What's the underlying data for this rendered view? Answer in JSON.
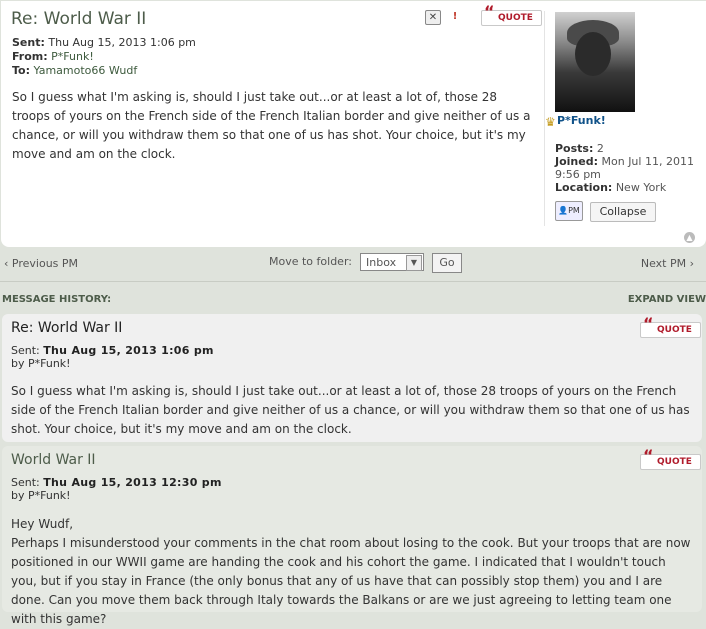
{
  "current_pm": {
    "title": "Re: World War II",
    "sent_label": "Sent:",
    "sent_value": "Thu Aug 15, 2013 1:06 pm",
    "from_label": "From:",
    "from_value": "P*Funk!",
    "to_label": "To:",
    "to_value": "Yamamoto66 Wudf",
    "quote_label": "QUOTE",
    "body": "So I guess what I'm asking is, should I just take out...or at least a lot of, those 28 troops of yours on the French side of the French Italian border and give neither of us a chance, or will you withdraw them so that one of us has shot. Your choice, but it's my move and am on the clock."
  },
  "profile": {
    "username": "P*Funk!",
    "posts_label": "Posts:",
    "posts_value": "2",
    "joined_label": "Joined:",
    "joined_value": "Mon Jul 11, 2011 9:56 pm",
    "location_label": "Location:",
    "location_value": "New York",
    "pm_label": "PM",
    "collapse_label": "Collapse"
  },
  "navigation": {
    "prev": "Previous PM",
    "next": "Next PM",
    "folder_label": "Move to folder:",
    "folder_selected": "Inbox",
    "go_label": "Go"
  },
  "history": {
    "header": "MESSAGE HISTORY:",
    "expand": "EXPAND VIEW",
    "messages": [
      {
        "title": "Re: World War II",
        "sent_label": "Sent:",
        "sent_value": "Thu Aug 15, 2013 1:06 pm",
        "by": "by P*Funk!",
        "quote_label": "QUOTE",
        "body": "So I guess what I'm asking is, should I just take out...or at least a lot of, those 28 troops of yours on the French side of the French Italian border and give neither of us a chance, or will you withdraw them so that one of us has shot. Your choice, but it's my move and am on the clock."
      },
      {
        "title": "World War II",
        "sent_label": "Sent:",
        "sent_value": "Thu Aug 15, 2013 12:30 pm",
        "by": "by P*Funk!",
        "quote_label": "QUOTE",
        "greeting": "Hey Wudf,",
        "body": "Perhaps I misunderstood your comments in the chat room about losing to the cook. But your troops that are now positioned in our WWII game are handing the cook and his cohort the game. I indicated that I wouldn't touch you, but if you stay in France (the only bonus that any of us have that can possibly stop them) you and I are done. Can you move them back through Italy towards the Balkans or are we just agreeing to letting team one with this game?"
      }
    ]
  },
  "colors": {
    "page_bg": "#dfe3dc",
    "title_green": "#4d5c4a",
    "quote_red": "#b01b2b",
    "username_blue": "#105289"
  },
  "icons": {
    "delete": "delete-icon",
    "report": "report-icon",
    "quote": "quote-icon",
    "crown": "crown-icon",
    "pm": "pm-icon",
    "back_to_top": "back-to-top-icon"
  }
}
